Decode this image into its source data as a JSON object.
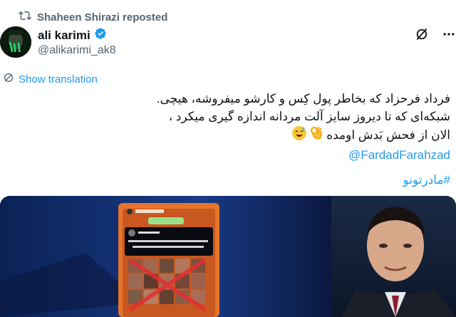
{
  "repost": {
    "text": "Shaheen Shirazi reposted"
  },
  "author": {
    "name": "ali karimi",
    "handle": "@alikarimi_ak8"
  },
  "translate": {
    "label": "Show translation"
  },
  "tweet": {
    "line1": "فرداد فرحزاد که بخاطر پول کِس و کارشو میفروشه، هیچی.",
    "line2": "شبکه‌ای که تا دیروز  سایز آلت مردانه  اندازه گیری میکرد ،",
    "line3": "الان از فحش بَدش اومده",
    "mention": "@FardadFarahzad",
    "hashtag": "#مادرتونو"
  },
  "colors": {
    "link": "#1d9bf0",
    "muted": "#536471",
    "verified": "#1d9bf0"
  }
}
